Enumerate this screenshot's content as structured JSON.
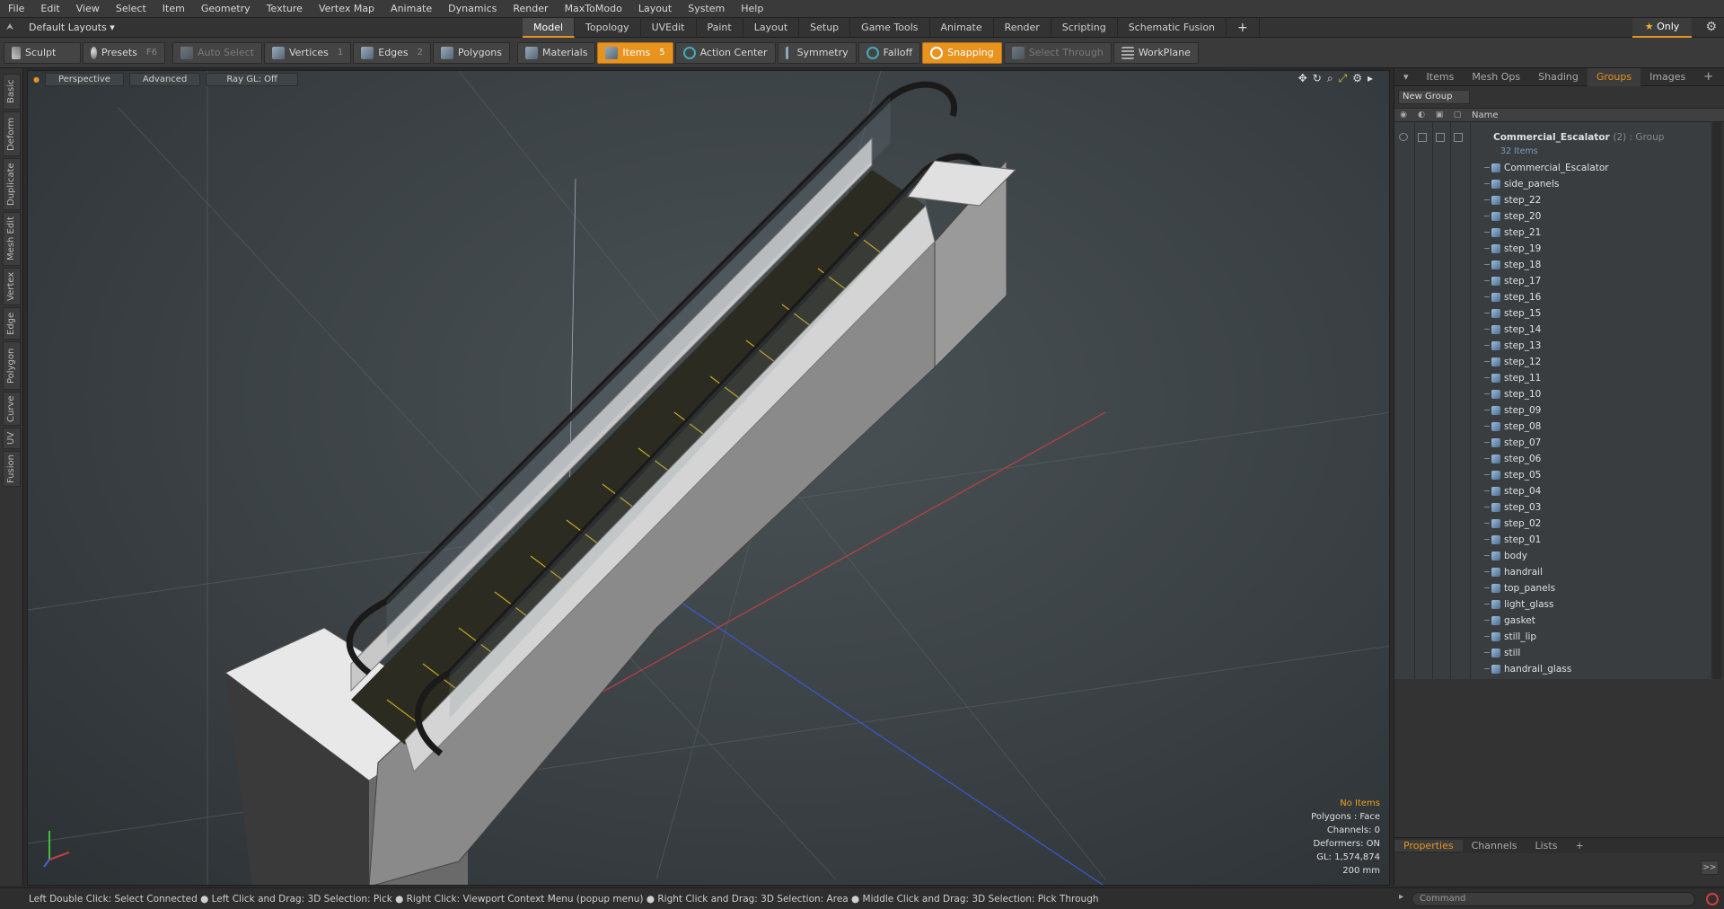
{
  "menu": [
    "File",
    "Edit",
    "View",
    "Select",
    "Item",
    "Geometry",
    "Texture",
    "Vertex Map",
    "Animate",
    "Dynamics",
    "Render",
    "MaxToModo",
    "Layout",
    "System",
    "Help"
  ],
  "layout_name": "Default Layouts ▾",
  "tabs": [
    "Model",
    "Topology",
    "UVEdit",
    "Paint",
    "Layout",
    "Setup",
    "Game Tools",
    "Animate",
    "Render",
    "Scripting",
    "Schematic Fusion"
  ],
  "tabs_plus": "+",
  "only_label": "Only",
  "toolbar": {
    "sculpt": "Sculpt",
    "presets": "Presets",
    "presets_key": "F6",
    "auto_select": "Auto Select",
    "vertices": "Vertices",
    "vertices_key": "1",
    "edges": "Edges",
    "edges_key": "2",
    "polygons": "Polygons",
    "materials": "Materials",
    "items": "Items",
    "items_key": "5",
    "action_center": "Action Center",
    "symmetry": "Symmetry",
    "falloff": "Falloff",
    "snapping": "Snapping",
    "select_through": "Select Through",
    "workplane": "WorkPlane"
  },
  "left_tabs": [
    "Basic",
    "Deform",
    "Duplicate",
    "Mesh Edit",
    "Vertex",
    "Edge",
    "Polygon",
    "Curve",
    "UV",
    "Fusion"
  ],
  "viewport": {
    "view": "Perspective",
    "shading": "Advanced",
    "raygl": "Ray GL: Off",
    "stats": {
      "items": "No Items",
      "polygons": "Polygons : Face",
      "channels": "Channels: 0",
      "deformers": "Deformers: ON",
      "gl": "GL: 1,574,874",
      "scale": "200 mm"
    }
  },
  "right_panel": {
    "tabs": [
      "Items",
      "Mesh Ops",
      "Shading",
      "Groups",
      "Images"
    ],
    "active_tab": "Groups",
    "tab_plus": "+",
    "new_group": "New Group",
    "col_name": "Name",
    "group_name": "Commercial_Escalator",
    "group_meta": "(2) : Group",
    "group_count": "32 Items",
    "items": [
      "Commercial_Escalator",
      "side_panels",
      "step_22",
      "step_20",
      "step_21",
      "step_19",
      "step_18",
      "step_17",
      "step_16",
      "step_15",
      "step_14",
      "step_13",
      "step_12",
      "step_11",
      "step_10",
      "step_09",
      "step_08",
      "step_07",
      "step_06",
      "step_05",
      "step_04",
      "step_03",
      "step_02",
      "step_01",
      "body",
      "handrail",
      "top_panels",
      "light_glass",
      "gasket",
      "still_lip",
      "still",
      "handrail_glass"
    ],
    "bottom_tabs": [
      "Properties",
      "Channels",
      "Lists"
    ],
    "bottom_plus": "+",
    "expand": ">>"
  },
  "status_text": "Left Double Click: Select Connected ● Left Click and Drag: 3D Selection: Pick ● Right Click: Viewport Context Menu (popup menu) ● Right Click and Drag: 3D Selection: Area ● Middle Click and Drag: 3D Selection: Pick Through",
  "command_placeholder": "Command",
  "colors": {
    "accent": "#e8931e",
    "viewport_bg": "#3a4044",
    "panel_bg": "#333333"
  }
}
